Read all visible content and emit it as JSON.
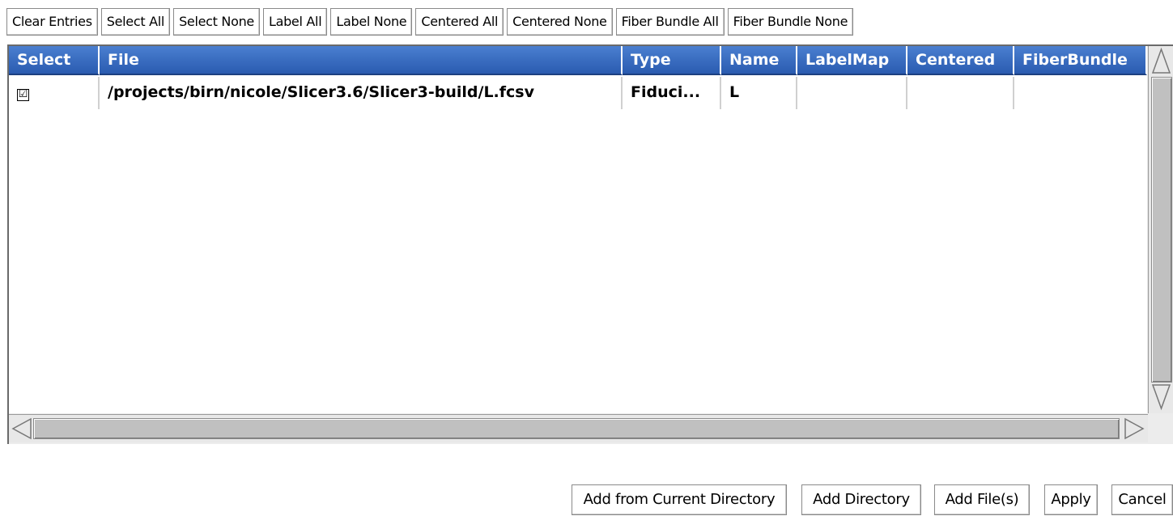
{
  "toolbar": {
    "buttons": [
      {
        "label": "Clear Entries"
      },
      {
        "label": "Select All"
      },
      {
        "label": "Select None"
      },
      {
        "label": "Label All"
      },
      {
        "label": "Label None"
      },
      {
        "label": "Centered All"
      },
      {
        "label": "Centered None"
      },
      {
        "label": "Fiber Bundle All"
      },
      {
        "label": "Fiber Bundle None"
      }
    ]
  },
  "table": {
    "columns": [
      "Select",
      "File",
      "Type",
      "Name",
      "LabelMap",
      "Centered",
      "FiberBundle"
    ],
    "rows": [
      {
        "selected": true,
        "check_glyph": "☑",
        "file": "/projects/birn/nicole/Slicer3.6/Slicer3-build/L.fcsv",
        "type": "Fiduci...",
        "name": "L",
        "labelmap": "",
        "centered": "",
        "fiberbundle": ""
      }
    ]
  },
  "colors": {
    "header_bg": "#2c5fb2",
    "header_text": "#ffffff"
  },
  "icons": {
    "scroll_up": "triangle-up-icon",
    "scroll_down": "triangle-down-icon",
    "scroll_left": "triangle-left-icon",
    "scroll_right": "triangle-right-icon"
  },
  "bottom_buttons": {
    "add_current_dir": "Add from Current Directory",
    "add_directory": "Add Directory",
    "add_files": "Add File(s)",
    "apply": "Apply",
    "cancel": "Cancel"
  }
}
